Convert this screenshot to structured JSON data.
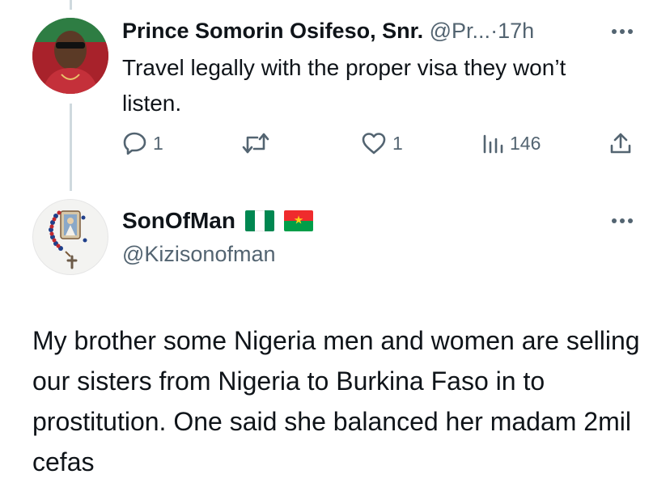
{
  "thread": {
    "reply": {
      "author": {
        "display_name": "Prince Somorin Osifeso, Snr.",
        "handle": "@Pr...",
        "separator": "·",
        "time": "17h"
      },
      "text": "Travel legally with the proper visa they won’t listen.",
      "actions": {
        "replies": "1",
        "likes": "1",
        "views": "146"
      }
    },
    "main": {
      "author": {
        "display_name": "SonOfMan",
        "handle": "@Kizisonofman",
        "flags": [
          "nigeria-flag",
          "burkina-faso-flag"
        ]
      },
      "text": "My brother some Nigeria men and women are selling our sisters from Nigeria to Burkina Faso in to prostitution. One said she balanced her madam 2mil cefas"
    }
  },
  "icons": {
    "reply": "reply-icon",
    "retweet": "retweet-icon",
    "like": "like-icon",
    "views": "views-icon",
    "share": "share-icon",
    "more": "more-icon"
  },
  "colors": {
    "text_primary": "#0f1419",
    "text_secondary": "#536471",
    "thread_line": "#cfd9de",
    "nigeria_green": "#008751",
    "burkina_red": "#ef2b2d",
    "burkina_green": "#009e49",
    "burkina_star": "#fcd116"
  }
}
